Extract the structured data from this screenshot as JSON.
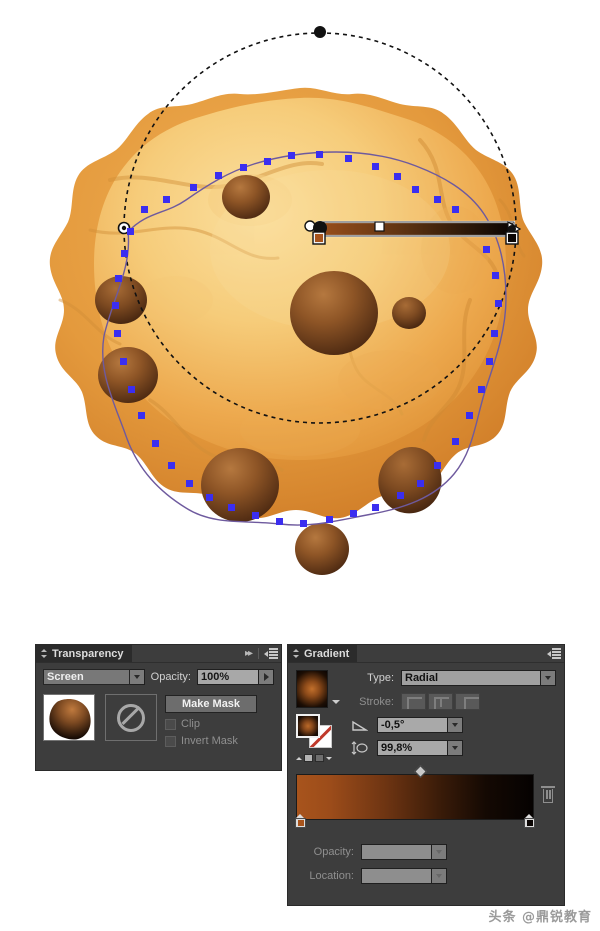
{
  "app": {
    "canvas_background": "#ffffff",
    "panel_background": "#3d3d3d"
  },
  "artwork": {
    "name": "chocolate-chip-cookie-illustration",
    "description": "Vector chocolate chip cookie with selected path, anchor points and radial gradient annotator",
    "cookie_light": "#f7cd7c",
    "cookie_mid": "#eaa94c",
    "cookie_dark": "#d98f33",
    "chip_light": "#b0713c",
    "chip_dark": "#5b3117",
    "anchor_color": "#3b2ef0",
    "path_color": "#6e5a9e"
  },
  "transparency": {
    "title": "Transparency",
    "collapse_icon": "double-chevron-right-icon",
    "menu_icon": "panel-menu-icon",
    "blend_mode": "Screen",
    "opacity_label": "Opacity:",
    "opacity_value": "100%",
    "make_mask_label": "Make Mask",
    "clip_label": "Clip",
    "clip_checked": false,
    "invert_mask_label": "Invert Mask",
    "invert_mask_checked": false,
    "mask_slot_icon": "no-entry-icon",
    "thumbnail_icon": "cookie-thumbnail"
  },
  "gradient": {
    "title": "Gradient",
    "menu_icon": "panel-menu-icon",
    "preview_icon": "radial-gradient-swatch",
    "preview_caret_icon": "chevron-down-icon",
    "fill_stroke_icon": "fill-stroke-indicator",
    "reverse_icon": "reverse-gradient-icon",
    "type_label": "Type:",
    "type_value": "Radial",
    "stroke_label": "Stroke:",
    "stroke_buttons": [
      "stroke-within-gradient-icon",
      "stroke-along-gradient-icon",
      "stroke-across-gradient-icon"
    ],
    "angle_icon": "gradient-angle-icon",
    "angle_value": "-0,5°",
    "aspect_icon": "gradient-aspect-ratio-icon",
    "aspect_value": "99,8%",
    "slider": {
      "start_color": "#a8541c",
      "end_color": "#050201",
      "midpoint_icon": "gradient-midpoint-diamond",
      "left_stop_icon": "gradient-stop-left",
      "right_stop_icon": "gradient-stop-right",
      "delete_icon": "trash-icon"
    },
    "opacity_label": "Opacity:",
    "opacity_value": "",
    "location_label": "Location:",
    "location_value": ""
  },
  "watermark": {
    "text": "头条 @鼎锐教育"
  }
}
